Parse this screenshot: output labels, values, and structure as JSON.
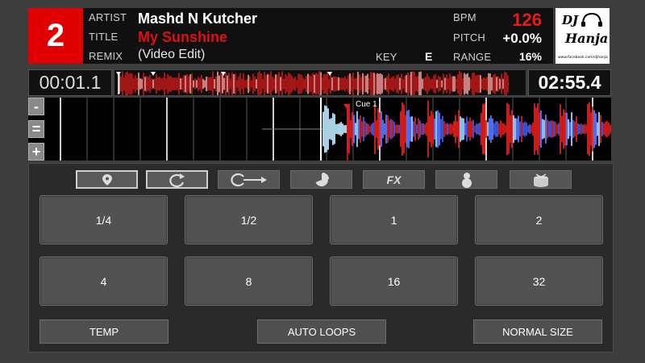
{
  "deck": {
    "number": "2"
  },
  "track": {
    "artist_label": "ARTIST",
    "artist": "Mashd N Kutcher",
    "title_label": "TITLE",
    "title": "My Sunshine",
    "remix_label": "REMIX",
    "remix": "(Video Edit)"
  },
  "tempo": {
    "bpm_label": "BPM",
    "bpm": "126",
    "pitch_label": "PITCH",
    "pitch": "+0.0%",
    "key_label": "KEY",
    "key": "E",
    "range_label": "RANGE",
    "range": "16%"
  },
  "logo": {
    "dj": "DJ",
    "name": "Hanja",
    "url": "www.facebook.com/djhanja"
  },
  "time": {
    "elapsed": "00:01.1",
    "remaining": "02:55.4"
  },
  "waveform": {
    "cue_label": "Cue 1"
  },
  "zoom": {
    "minus": "-",
    "reset": "=",
    "plus": "+"
  },
  "modes": [
    {
      "icon": "cue-marker-icon"
    },
    {
      "icon": "loop-icon"
    },
    {
      "icon": "loop-roll-icon"
    },
    {
      "icon": "slicer-icon"
    },
    {
      "icon": "fx-icon",
      "label": "FX"
    },
    {
      "icon": "sampler-icon"
    },
    {
      "icon": "drum-icon"
    }
  ],
  "pads": [
    "1/4",
    "1/2",
    "1",
    "2",
    "4",
    "8",
    "16",
    "32"
  ],
  "bottom": {
    "left": "TEMP",
    "center": "AUTO LOOPS",
    "right": "NORMAL SIZE"
  },
  "colors": {
    "deck": "#e00000",
    "accent": "#e81a1a",
    "wave_red": "#d41b1b",
    "wave_blue": "#4a6cff"
  }
}
